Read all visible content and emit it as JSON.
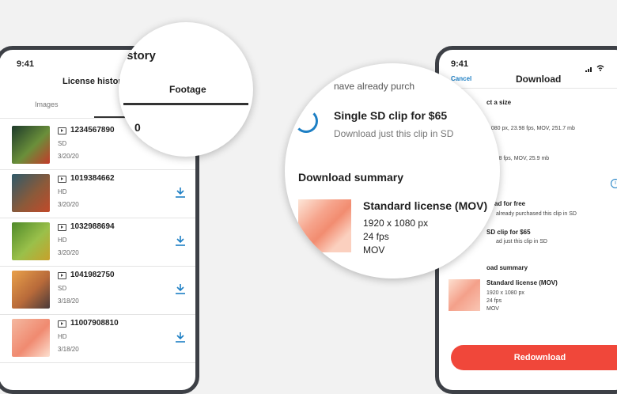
{
  "left_phone": {
    "time": "9:41",
    "title": "License history",
    "tabs": [
      "Images",
      "Footage"
    ],
    "clips": [
      {
        "id": "1234567890",
        "res": "SD",
        "date": "3/20/20",
        "thumb_colors": [
          "#1d3a2a",
          "#6a8f3a",
          "#c43a2a"
        ],
        "download": false
      },
      {
        "id": "1019384662",
        "res": "HD",
        "date": "3/20/20",
        "thumb_colors": [
          "#2f5a6a",
          "#8a5a3a",
          "#c24a2a"
        ],
        "download": true
      },
      {
        "id": "1032988694",
        "res": "HD",
        "date": "3/20/20",
        "thumb_colors": [
          "#4f8a2a",
          "#9ac04a",
          "#c8a02a"
        ],
        "download": true
      },
      {
        "id": "1041982750",
        "res": "SD",
        "date": "3/18/20",
        "thumb_colors": [
          "#e8a04a",
          "#b86a3a",
          "#4a3a3a"
        ],
        "download": true
      },
      {
        "id": "11007908810",
        "res": "HD",
        "date": "3/18/20",
        "thumb_colors": [
          "#f4b8a0",
          "#f08a70",
          "#fde0d0"
        ],
        "download": true
      }
    ]
  },
  "magnifier_left": {
    "title_fragment": "istory",
    "tab": "Footage",
    "fragment": "0"
  },
  "magnifier_center": {
    "top_text": "nave already purch",
    "option_title": "Single SD clip for $65",
    "option_sub": "Download just this clip in SD",
    "summary_heading": "Download summary",
    "license": "Standard license (MOV)",
    "res": "1920 x 1080 px",
    "fps": "24 fps",
    "format": "MOV"
  },
  "right_phone": {
    "time": "9:41",
    "cancel": "Cancel",
    "title": "Download",
    "select_size": "ct a size",
    "size1": "1080 px, 23.98 fps, MOV, 251.7 mb",
    "size2": "23.98 fps, MOV, 25.9 mb",
    "section_fragment": "s",
    "free_title": "ad for free",
    "free_sub": "already purchased this clip in SD",
    "paid_title": "SD clip for $65",
    "paid_sub": "ad just this clip in SD",
    "summary_heading": "oad summary",
    "license": "Standard license (MOV)",
    "res": "1920 x 1080 px",
    "fps": "24 fps",
    "format": "MOV",
    "button": "Redownload"
  },
  "colors": {
    "accent": "#1d7fc4",
    "button": "#f0473a",
    "frame": "#3d4046"
  }
}
